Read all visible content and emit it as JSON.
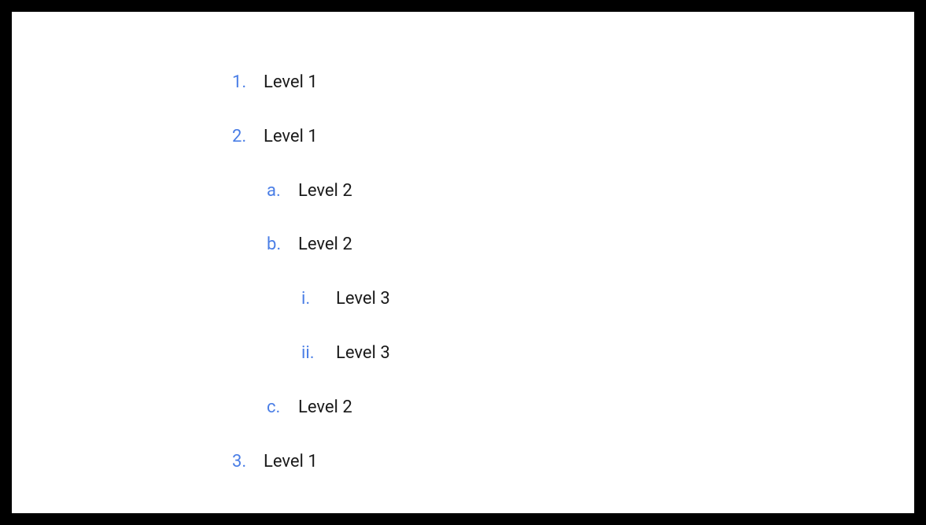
{
  "list": [
    {
      "level": 1,
      "marker": "1.",
      "label": "Level 1"
    },
    {
      "level": 1,
      "marker": "2.",
      "label": "Level 1"
    },
    {
      "level": 2,
      "marker": "a.",
      "label": "Level 2"
    },
    {
      "level": 2,
      "marker": "b.",
      "label": "Level 2"
    },
    {
      "level": 3,
      "marker": "i.",
      "label": "Level 3"
    },
    {
      "level": 3,
      "marker": "ii.",
      "label": "Level 3"
    },
    {
      "level": 2,
      "marker": "c.",
      "label": "Level 2"
    },
    {
      "level": 1,
      "marker": "3.",
      "label": "Level 1"
    }
  ],
  "colors": {
    "marker": "#4a7ee6",
    "text": "#1a1a1a",
    "background": "#ffffff"
  }
}
